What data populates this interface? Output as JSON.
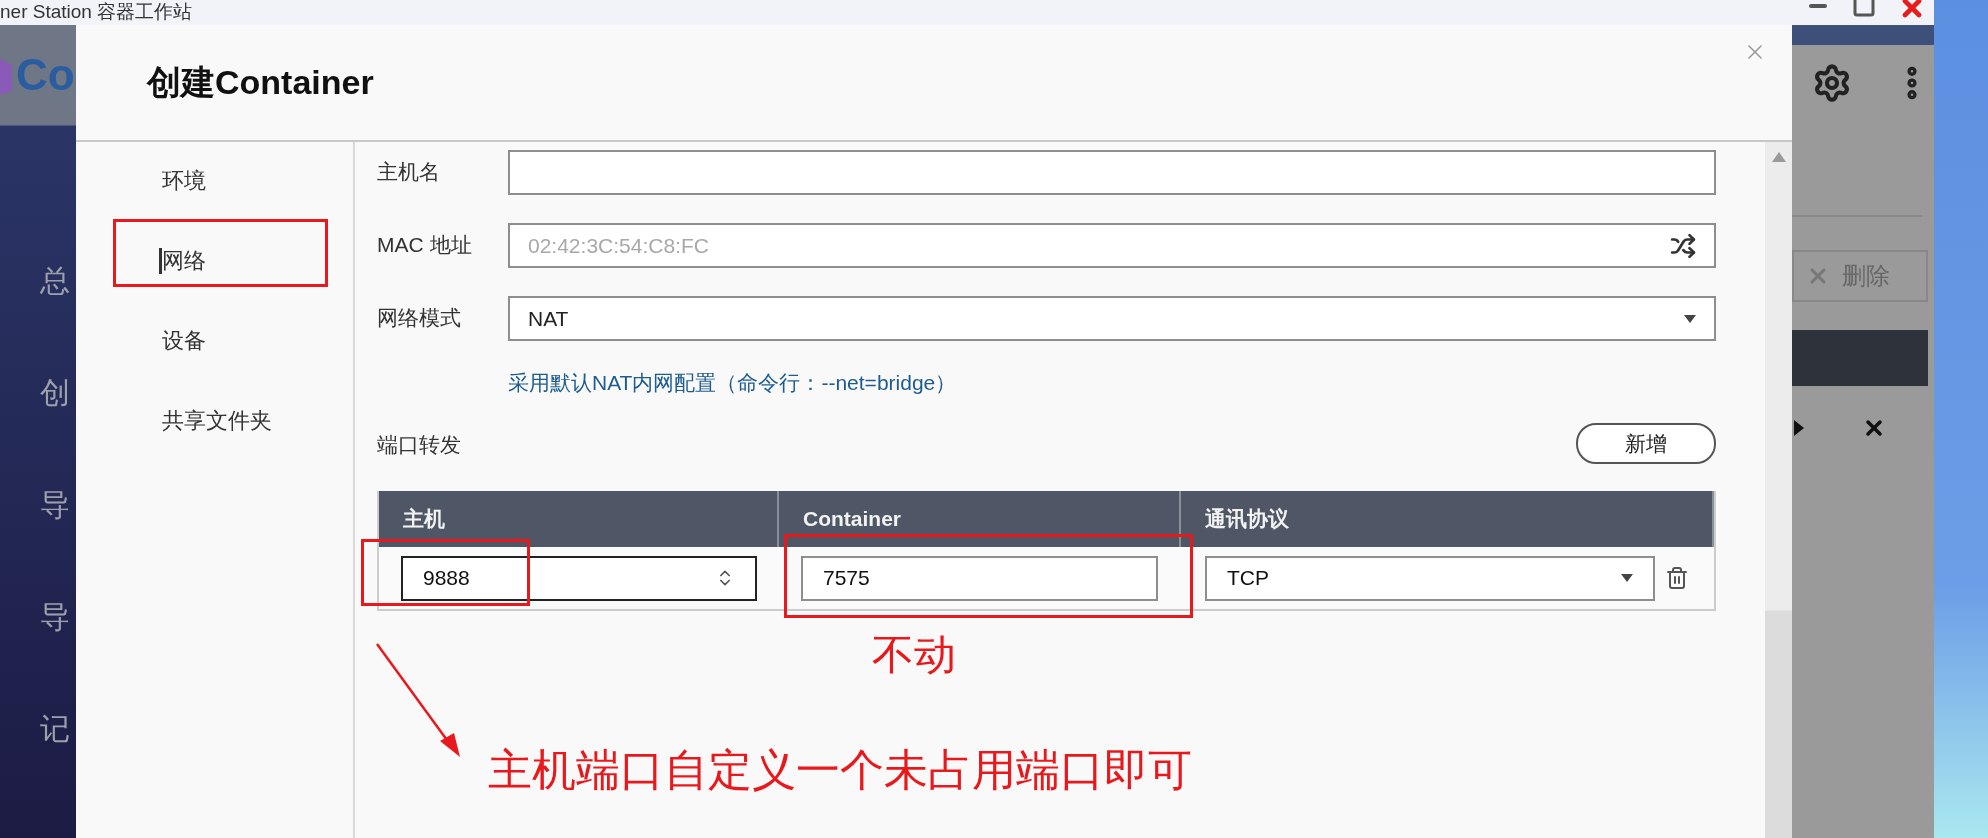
{
  "app_window": {
    "title": "ner Station 容器工作站",
    "logo_text": "Co",
    "nav_items": [
      "总",
      "创",
      "导",
      "导",
      "记"
    ],
    "delete_button": "删除"
  },
  "dialog": {
    "title": "创建Container",
    "nav": [
      {
        "label": "环境",
        "selected": false
      },
      {
        "label": "网络",
        "selected": true
      },
      {
        "label": "设备",
        "selected": false
      },
      {
        "label": "共享文件夹",
        "selected": false
      }
    ],
    "fields": [
      {
        "kind": "text",
        "label": "主机名"
      },
      {
        "kind": "random",
        "label": "MAC 地址",
        "placeholder": "02:42:3C:54:C8:FC"
      },
      {
        "kind": "select",
        "label": "网络模式",
        "value": "NAT"
      }
    ],
    "hint": "采用默认NAT内网配置（命令行：--net=bridge）",
    "port_forwarding": {
      "label": "端口转发",
      "add_button": "新增",
      "columns": [
        "主机",
        "Container",
        "通讯协议"
      ],
      "rows": [
        {
          "host": "9888",
          "container": "7575",
          "protocol": "TCP"
        }
      ]
    }
  },
  "annotations": [
    {
      "kind": "note",
      "text": "不动"
    },
    {
      "kind": "instruction",
      "text": "主机端口自定义一个未占用端口即可"
    }
  ]
}
